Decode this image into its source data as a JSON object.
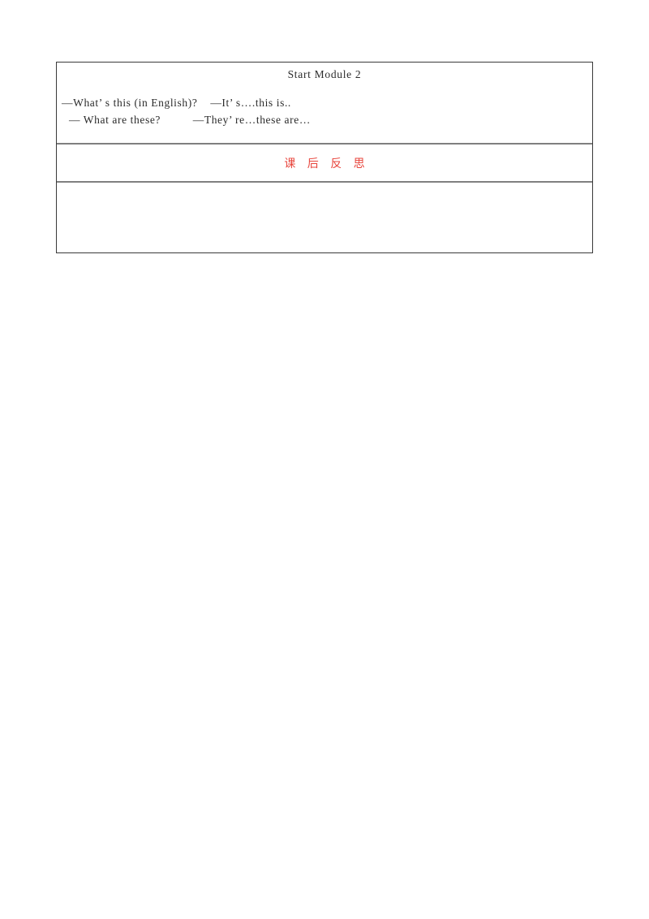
{
  "document": {
    "table": {
      "rows": [
        {
          "id": "objectives",
          "title": "Start Module 2",
          "lines": [
            "—What’ s this (in English)?    —It’ s….this is..",
            " — What are these?          —They’ re…these are…"
          ]
        },
        {
          "id": "reflection",
          "title": "课 后 反 思",
          "color": "#e8453c"
        },
        {
          "id": "notes",
          "content": ""
        }
      ]
    }
  }
}
